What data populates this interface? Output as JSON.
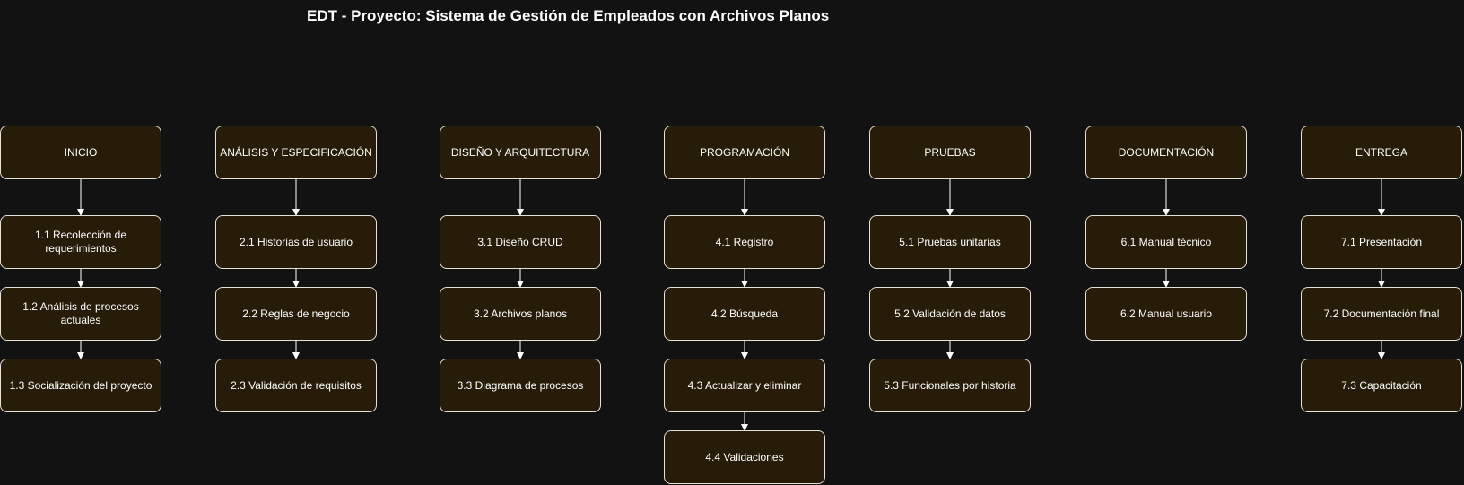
{
  "title": "EDT - Proyecto: Sistema de Gestión de Empleados con Archivos Planos",
  "colors": {
    "background": "#121212",
    "node_fill": "#271c08",
    "node_border": "#e6e0d6",
    "connector": "#ffffff",
    "text": "#ffffff"
  },
  "phases": [
    {
      "label": "INICIO",
      "children": [
        {
          "label": "1.1 Recolección de requerimientos"
        },
        {
          "label": "1.2 Análisis de procesos actuales"
        },
        {
          "label": "1.3 Socialización del proyecto"
        }
      ]
    },
    {
      "label": "ANÁLISIS Y ESPECIFICACIÓN",
      "children": [
        {
          "label": "2.1 Historias de usuario"
        },
        {
          "label": "2.2 Reglas de negocio"
        },
        {
          "label": "2.3 Validación de requisitos"
        }
      ]
    },
    {
      "label": "DISEÑO Y ARQUITECTURA",
      "children": [
        {
          "label": "3.1 Diseño CRUD"
        },
        {
          "label": "3.2 Archivos planos"
        },
        {
          "label": "3.3 Diagrama de procesos"
        }
      ]
    },
    {
      "label": "PROGRAMACIÓN",
      "children": [
        {
          "label": "4.1 Registro"
        },
        {
          "label": "4.2 Búsqueda"
        },
        {
          "label": "4.3 Actualizar y eliminar"
        },
        {
          "label": "4.4 Validaciones"
        }
      ]
    },
    {
      "label": "PRUEBAS",
      "children": [
        {
          "label": "5.1 Pruebas unitarias"
        },
        {
          "label": "5.2 Validación de datos"
        },
        {
          "label": "5.3 Funcionales por historia"
        }
      ]
    },
    {
      "label": "DOCUMENTACIÓN",
      "children": [
        {
          "label": "6.1 Manual técnico"
        },
        {
          "label": "6.2 Manual usuario"
        }
      ]
    },
    {
      "label": "ENTREGA",
      "children": [
        {
          "label": "7.1 Presentación"
        },
        {
          "label": "7.2 Documentación final"
        },
        {
          "label": "7.3 Capacitación"
        }
      ]
    }
  ]
}
